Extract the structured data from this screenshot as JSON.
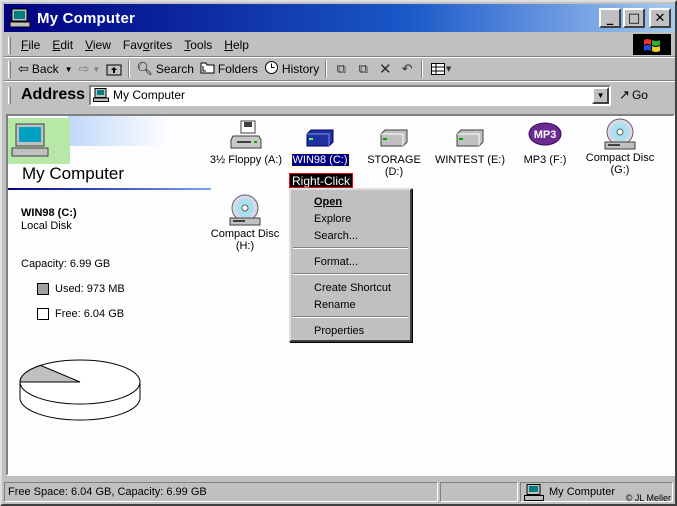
{
  "window": {
    "title": "My Computer"
  },
  "title_buttons": {
    "minimize": "_",
    "maximize": "□",
    "close": "✕"
  },
  "menu": {
    "items": [
      {
        "key": "F",
        "rest": "ile"
      },
      {
        "key": "E",
        "rest": "dit"
      },
      {
        "key": "V",
        "rest": "iew"
      },
      {
        "key": "",
        "pre": "Fav",
        "keymid": "o",
        "rest": "rites"
      },
      {
        "key": "T",
        "rest": "ools"
      },
      {
        "key": "H",
        "rest": "elp"
      }
    ]
  },
  "toolbar": {
    "back_label": "Back",
    "search_label": "Search",
    "folders_label": "Folders",
    "history_label": "History"
  },
  "address": {
    "label": "Address",
    "value": "My Computer",
    "go_label": "Go"
  },
  "left_panel": {
    "title": "My Computer",
    "drive_name": "WIN98 (C:)",
    "drive_type": "Local Disk",
    "capacity": "Capacity: 6.99 GB",
    "used": "Used: 973 MB",
    "free": "Free: 6.04 GB",
    "used_fraction": 0.136,
    "colors": {
      "used": "#c0c0c0",
      "free": "#ffffff"
    }
  },
  "drives": [
    {
      "id": "floppy",
      "label": "3½ Floppy (A:)",
      "icon": "floppy-drive-icon"
    },
    {
      "id": "c",
      "label": "WIN98 (C:)",
      "icon": "hard-drive-icon",
      "selected": true
    },
    {
      "id": "d",
      "label1": "STORAGE",
      "label2": "(D:)",
      "icon": "hard-drive-icon"
    },
    {
      "id": "e",
      "label": "WINTEST (E:)",
      "icon": "hard-drive-icon"
    },
    {
      "id": "f",
      "label": "MP3 (F:)",
      "icon": "mp3-drive-icon"
    },
    {
      "id": "g",
      "label1": "Compact Disc",
      "label2": "(G:)",
      "icon": "cd-drive-icon"
    },
    {
      "id": "h",
      "label1": "Compact Disc",
      "label2": "(H:)",
      "icon": "cd-drive-icon"
    }
  ],
  "tooltip": "Right-Click",
  "context_menu": {
    "open": "Open",
    "explore": "Explore",
    "search": "Search...",
    "format": "Format...",
    "create_shortcut": "Create Shortcut",
    "rename": "Rename",
    "properties": "Properties"
  },
  "status": {
    "text": "Free Space: 6.04 GB, Capacity: 6.99 GB",
    "zone": "My Computer",
    "copyright": "© JL Meller"
  }
}
